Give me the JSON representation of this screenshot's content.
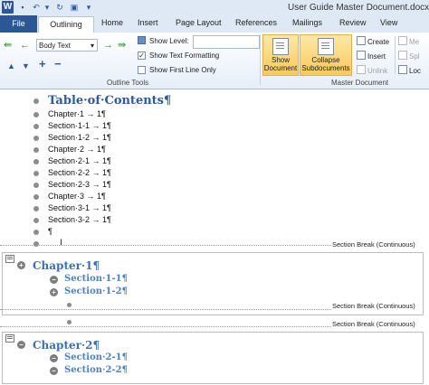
{
  "titlebar": {
    "title": "User Guide Master Document.docx -",
    "app_logo": "W"
  },
  "tabs": [
    "File",
    "Outlining",
    "Home",
    "Insert",
    "Page Layout",
    "References",
    "Mailings",
    "Review",
    "View"
  ],
  "ribbon": {
    "outline_tools": {
      "level_value": "Body Text",
      "show_level_label": "Show Level:",
      "show_text_formatting": "Show Text Formatting",
      "show_first_line_only": "Show First Line Only",
      "group_label": "Outline Tools"
    },
    "master_document": {
      "show_document": "Show Document",
      "collapse_subdocuments": "Collapse Subdocuments",
      "create": "Create",
      "insert": "Insert",
      "unlink": "Unlink",
      "me": "Me",
      "spl": "Spl",
      "loc": "Loc",
      "group_label": "Master Document"
    }
  },
  "document": {
    "toc_title": "Table·of·Contents¶",
    "toc_lines": [
      "Chapter·1  →  1¶",
      "Section·1-1  →  1¶",
      "Section·1-2  →  1¶",
      "Chapter·2  →  1¶",
      "Section·2-1  →  1¶",
      "Section·2-2  →  1¶",
      "Section·2-3  →  1¶",
      "Chapter·3  →  1¶",
      "Section·3-1  →  1¶",
      "Section·3-2  →  1¶",
      "¶"
    ],
    "section_break": "Section Break (Continuous)",
    "sub1": {
      "chapter": "Chapter·1¶",
      "sections": [
        "Section·1-1¶",
        "Section·1-2¶"
      ]
    },
    "sub2": {
      "chapter": "Chapter·2¶",
      "sections": [
        "Section·2-1¶",
        "Section·2-2¶"
      ]
    }
  }
}
